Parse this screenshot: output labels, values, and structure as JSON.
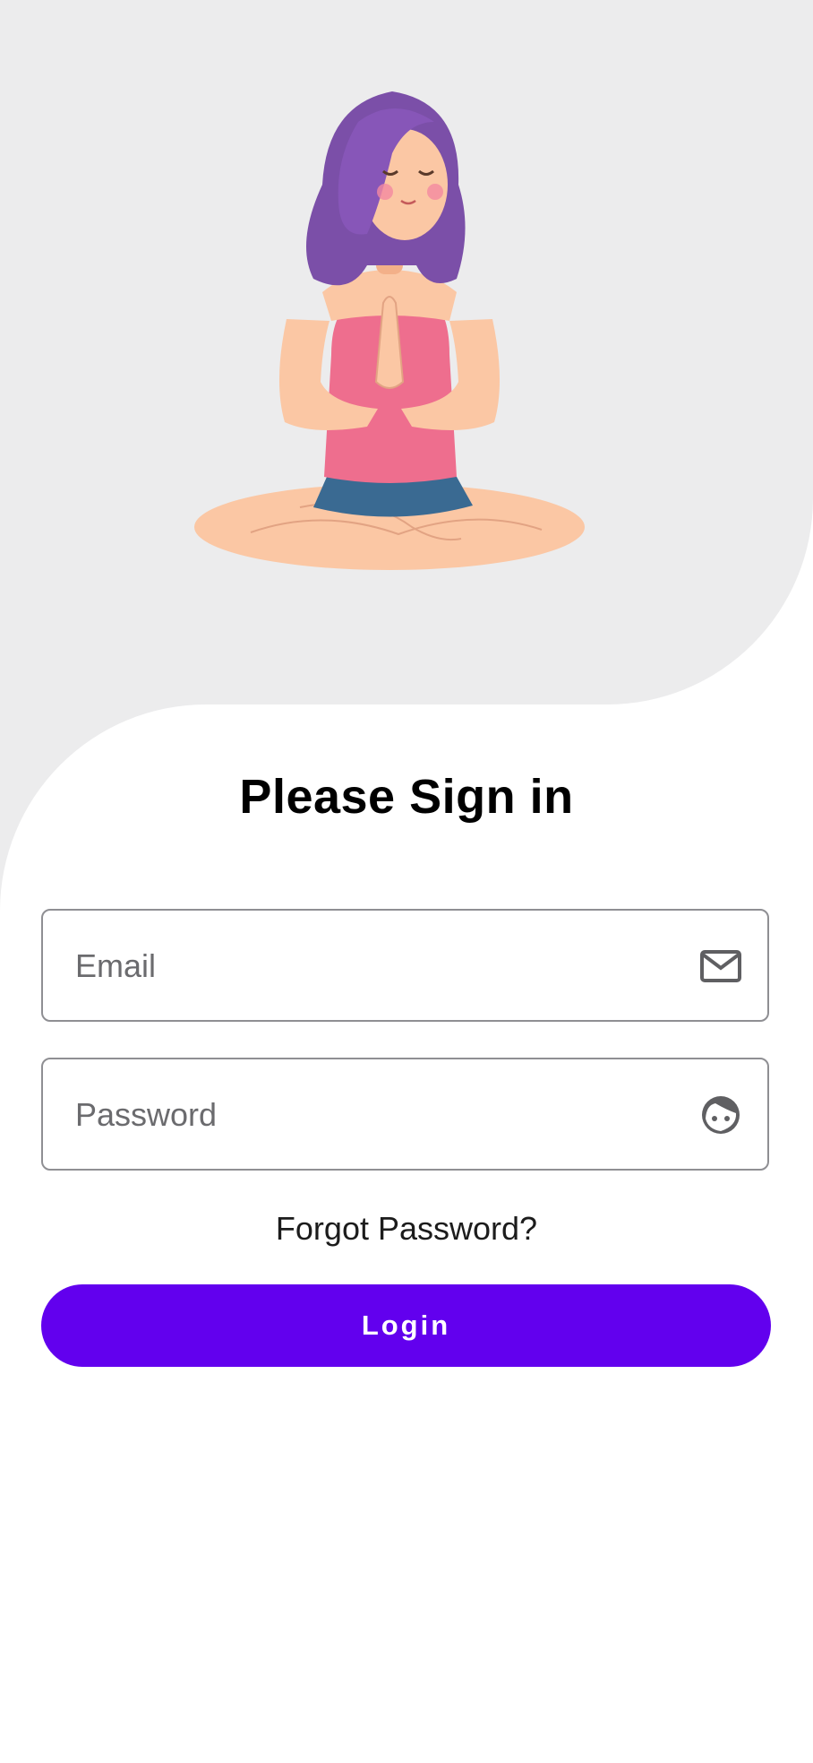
{
  "header": {
    "illustration": "woman-meditating-yoga-illustration"
  },
  "title": "Please Sign in",
  "email_field": {
    "placeholder": "Email",
    "value": "",
    "icon": "mail-icon"
  },
  "password_field": {
    "placeholder": "Password",
    "value": "",
    "icon": "face-icon"
  },
  "forgot_password": "Forgot Password?",
  "login_button": "Login",
  "colors": {
    "header_background": "#ececed",
    "primary": "#6200ee",
    "field_border": "#8f8f93"
  }
}
